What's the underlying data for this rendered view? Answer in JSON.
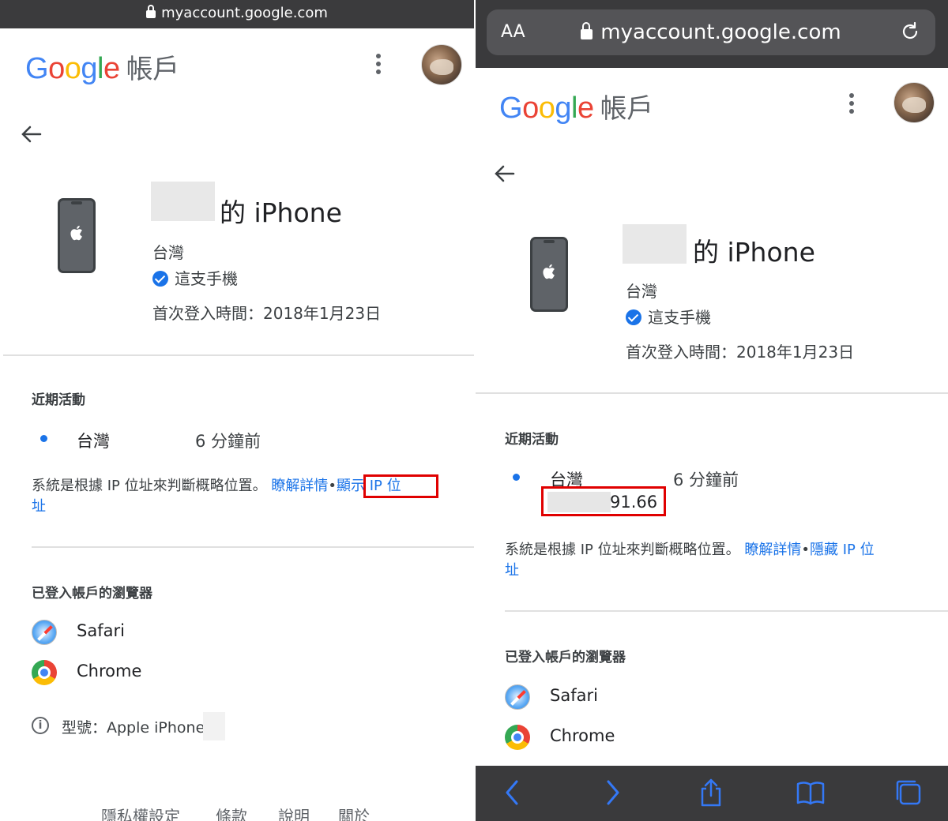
{
  "left": {
    "address": "myaccount.google.com",
    "logo_account": "帳戶",
    "device_name_suffix": "的 iPhone",
    "location": "台灣",
    "this_phone": "這支手機",
    "first_signin": "首次登入時間：2018年1月23日",
    "recent_title": "近期活動",
    "recent_location": "台灣",
    "recent_time": "6 分鐘前",
    "note_text": "系統是根據 IP 位址來判斷概略位置。",
    "note_learn": "瞭解詳情",
    "note_sep": "•",
    "note_ip_link_1": "顯示 IP 位",
    "note_ip_link_2": "址",
    "browsers_title": "已登入帳戶的瀏覽器",
    "browsers": [
      "Safari",
      "Chrome"
    ],
    "model": "型號：Apple iPhone",
    "footer": [
      "隱私權設定",
      "條款",
      "說明",
      "關於"
    ]
  },
  "right": {
    "aa": "AA",
    "address": "myaccount.google.com",
    "logo_account": "帳戶",
    "device_name_suffix": "的 iPhone",
    "location": "台灣",
    "this_phone": "這支手機",
    "first_signin": "首次登入時間：2018年1月23日",
    "recent_title": "近期活動",
    "recent_location": "台灣",
    "recent_time": "6 分鐘前",
    "ip_partial": "91.66",
    "note_text": "系統是根據 IP 位址來判斷概略位置。",
    "note_learn": "瞭解詳情",
    "note_sep": "•",
    "note_ip_link_1": "隱藏 IP 位",
    "note_ip_link_2": "址",
    "browsers_title": "已登入帳戶的瀏覽器",
    "browsers": [
      "Safari",
      "Chrome"
    ]
  },
  "colors": {
    "google_blue": "#4285f4",
    "google_red": "#ea4335",
    "google_yellow": "#fbbc05",
    "google_green": "#34a853",
    "link": "#1a73e8",
    "highlight": "#e00000"
  }
}
